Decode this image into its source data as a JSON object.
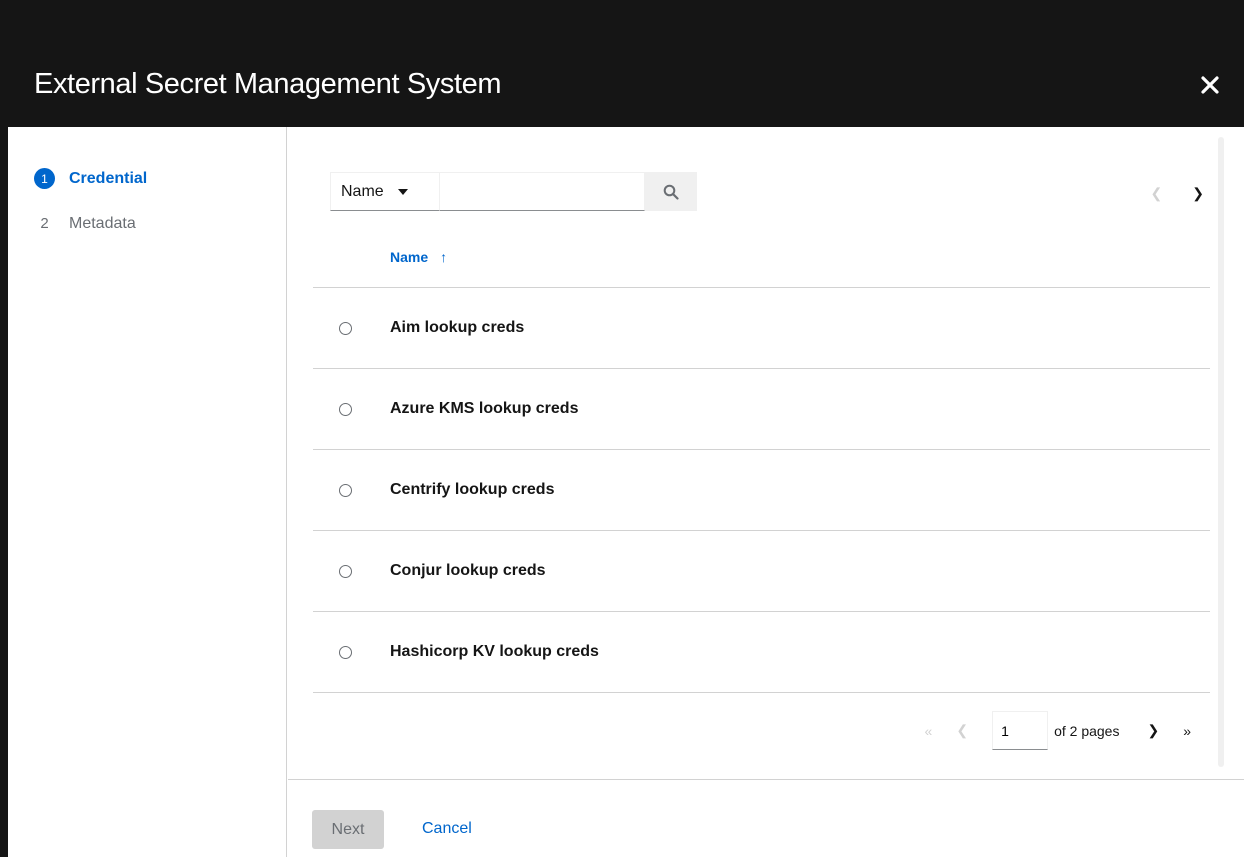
{
  "modal": {
    "title": "External Secret Management System",
    "close_icon": "close-icon"
  },
  "wizard": {
    "steps": [
      {
        "number": "1",
        "label": "Credential",
        "active": true
      },
      {
        "number": "2",
        "label": "Metadata",
        "active": false
      }
    ]
  },
  "toolbar": {
    "filter_label": "Name",
    "search_value": "",
    "search_icon": "search-icon"
  },
  "table": {
    "column_header": "Name",
    "sort_icon": "arrow-up-icon",
    "rows": [
      {
        "name": "Aim lookup creds"
      },
      {
        "name": "Azure KMS lookup creds"
      },
      {
        "name": "Centrify lookup creds"
      },
      {
        "name": "Conjur lookup creds"
      },
      {
        "name": "Hashicorp KV lookup creds"
      }
    ]
  },
  "pagination": {
    "current_page": "1",
    "of_pages": "of 2 pages"
  },
  "footer": {
    "next_label": "Next",
    "cancel_label": "Cancel"
  },
  "colors": {
    "accent": "#0066cc",
    "header_bg": "#151515"
  }
}
